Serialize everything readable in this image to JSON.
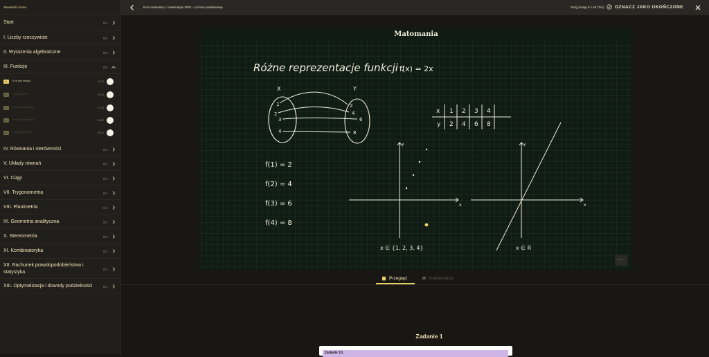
{
  "sidebar": {
    "back_link": "Zawartość kursu",
    "sections": [
      {
        "label": "Start",
        "count": "0/1",
        "open": false
      },
      {
        "label": "I. Liczby rzeczywiste",
        "count": "5/6",
        "open": false
      },
      {
        "label": "II. Wyrażenia algebraiczne",
        "count": "0/3",
        "open": false
      },
      {
        "label": "III. Funkcje",
        "count": "0/5",
        "open": true
      },
      {
        "label": "IV. Równania i nierówności",
        "count": "2/3",
        "open": false
      },
      {
        "label": "V. Układy równań",
        "count": "0/2",
        "open": false
      },
      {
        "label": "VI. Ciągi",
        "count": "0/3",
        "open": false
      },
      {
        "label": "VII. Trygonometria",
        "count": "0/3",
        "open": false
      },
      {
        "label": "VIII. Planimetria",
        "count": "0/4",
        "open": false
      },
      {
        "label": "IX. Geometria analityczna",
        "count": "0/4",
        "open": false
      },
      {
        "label": "X. Stereometria",
        "count": "0/2",
        "open": false
      },
      {
        "label": "XI. Kombinatoryka",
        "count": "0/2",
        "open": false
      },
      {
        "label": "XII. Rachunek prawdopodobieństwa i statystyka",
        "count": "0/3",
        "open": false
      },
      {
        "label": "XIII. Optymalizacja i dowody podzielności",
        "count": "0/2",
        "open": false
      }
    ],
    "lessons": [
      {
        "title": "Co to jest funkcja",
        "duration": "05:35",
        "active": true
      },
      {
        "title": "Funkcja liniowa",
        "duration": "09:36",
        "active": false
      },
      {
        "title": "Funkcja kwadratowa",
        "duration": "07:20",
        "active": false
      },
      {
        "title": "Funkcja wykładnicza",
        "duration": "06:08",
        "active": false
      },
      {
        "title": "Funkcja wymierna",
        "duration": "08:14",
        "active": false
      }
    ]
  },
  "topbar": {
    "course_title": "Kurs maturalny z matematyki 2025 – poziom podstawowy",
    "progress": "Twój postęp 9 z 46 (7%)",
    "mark_complete": "OZNACZ JAKO UKOŃCZONE"
  },
  "video": {
    "title": "Matomania",
    "heading": "Różne reprezentacje funkcji :",
    "formula": "f(x) = 2x",
    "set_x": "X",
    "set_y": "Y",
    "domain_elems": [
      "1",
      "2",
      "3",
      "4"
    ],
    "range_elems": [
      "2",
      "4",
      "6",
      "8"
    ],
    "table_x_label": "x",
    "table_y_label": "y",
    "values_list": [
      "f(1) = 2",
      "f(2) = 4",
      "f(3) = 6",
      "f(4) = 8"
    ],
    "domain_discrete": "x ∈ {1, 2, 3, 4}",
    "domain_real": "x ∈ R",
    "axis_x": "x",
    "axis_y": "y",
    "watermark": "Matomania"
  },
  "tabs": [
    {
      "label": "Przegląd",
      "active": true
    },
    {
      "label": "Komentarze",
      "active": false
    }
  ],
  "task": {
    "heading": "Zadanie 1",
    "card_title": "Zadanie 10."
  },
  "colors": {
    "accent": "#e8cf6a",
    "board": "#0f1b13",
    "sidebar": "#211f1b"
  }
}
